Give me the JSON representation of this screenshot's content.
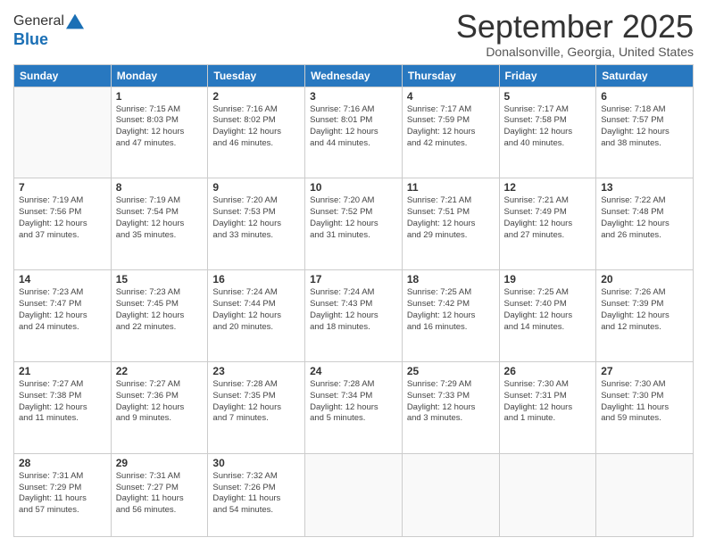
{
  "header": {
    "logo_line1": "General",
    "logo_line2": "Blue",
    "month_title": "September 2025",
    "subtitle": "Donalsonville, Georgia, United States"
  },
  "days_of_week": [
    "Sunday",
    "Monday",
    "Tuesday",
    "Wednesday",
    "Thursday",
    "Friday",
    "Saturday"
  ],
  "weeks": [
    [
      {
        "day": "",
        "info": ""
      },
      {
        "day": "1",
        "info": "Sunrise: 7:15 AM\nSunset: 8:03 PM\nDaylight: 12 hours\nand 47 minutes."
      },
      {
        "day": "2",
        "info": "Sunrise: 7:16 AM\nSunset: 8:02 PM\nDaylight: 12 hours\nand 46 minutes."
      },
      {
        "day": "3",
        "info": "Sunrise: 7:16 AM\nSunset: 8:01 PM\nDaylight: 12 hours\nand 44 minutes."
      },
      {
        "day": "4",
        "info": "Sunrise: 7:17 AM\nSunset: 7:59 PM\nDaylight: 12 hours\nand 42 minutes."
      },
      {
        "day": "5",
        "info": "Sunrise: 7:17 AM\nSunset: 7:58 PM\nDaylight: 12 hours\nand 40 minutes."
      },
      {
        "day": "6",
        "info": "Sunrise: 7:18 AM\nSunset: 7:57 PM\nDaylight: 12 hours\nand 38 minutes."
      }
    ],
    [
      {
        "day": "7",
        "info": "Sunrise: 7:19 AM\nSunset: 7:56 PM\nDaylight: 12 hours\nand 37 minutes."
      },
      {
        "day": "8",
        "info": "Sunrise: 7:19 AM\nSunset: 7:54 PM\nDaylight: 12 hours\nand 35 minutes."
      },
      {
        "day": "9",
        "info": "Sunrise: 7:20 AM\nSunset: 7:53 PM\nDaylight: 12 hours\nand 33 minutes."
      },
      {
        "day": "10",
        "info": "Sunrise: 7:20 AM\nSunset: 7:52 PM\nDaylight: 12 hours\nand 31 minutes."
      },
      {
        "day": "11",
        "info": "Sunrise: 7:21 AM\nSunset: 7:51 PM\nDaylight: 12 hours\nand 29 minutes."
      },
      {
        "day": "12",
        "info": "Sunrise: 7:21 AM\nSunset: 7:49 PM\nDaylight: 12 hours\nand 27 minutes."
      },
      {
        "day": "13",
        "info": "Sunrise: 7:22 AM\nSunset: 7:48 PM\nDaylight: 12 hours\nand 26 minutes."
      }
    ],
    [
      {
        "day": "14",
        "info": "Sunrise: 7:23 AM\nSunset: 7:47 PM\nDaylight: 12 hours\nand 24 minutes."
      },
      {
        "day": "15",
        "info": "Sunrise: 7:23 AM\nSunset: 7:45 PM\nDaylight: 12 hours\nand 22 minutes."
      },
      {
        "day": "16",
        "info": "Sunrise: 7:24 AM\nSunset: 7:44 PM\nDaylight: 12 hours\nand 20 minutes."
      },
      {
        "day": "17",
        "info": "Sunrise: 7:24 AM\nSunset: 7:43 PM\nDaylight: 12 hours\nand 18 minutes."
      },
      {
        "day": "18",
        "info": "Sunrise: 7:25 AM\nSunset: 7:42 PM\nDaylight: 12 hours\nand 16 minutes."
      },
      {
        "day": "19",
        "info": "Sunrise: 7:25 AM\nSunset: 7:40 PM\nDaylight: 12 hours\nand 14 minutes."
      },
      {
        "day": "20",
        "info": "Sunrise: 7:26 AM\nSunset: 7:39 PM\nDaylight: 12 hours\nand 12 minutes."
      }
    ],
    [
      {
        "day": "21",
        "info": "Sunrise: 7:27 AM\nSunset: 7:38 PM\nDaylight: 12 hours\nand 11 minutes."
      },
      {
        "day": "22",
        "info": "Sunrise: 7:27 AM\nSunset: 7:36 PM\nDaylight: 12 hours\nand 9 minutes."
      },
      {
        "day": "23",
        "info": "Sunrise: 7:28 AM\nSunset: 7:35 PM\nDaylight: 12 hours\nand 7 minutes."
      },
      {
        "day": "24",
        "info": "Sunrise: 7:28 AM\nSunset: 7:34 PM\nDaylight: 12 hours\nand 5 minutes."
      },
      {
        "day": "25",
        "info": "Sunrise: 7:29 AM\nSunset: 7:33 PM\nDaylight: 12 hours\nand 3 minutes."
      },
      {
        "day": "26",
        "info": "Sunrise: 7:30 AM\nSunset: 7:31 PM\nDaylight: 12 hours\nand 1 minute."
      },
      {
        "day": "27",
        "info": "Sunrise: 7:30 AM\nSunset: 7:30 PM\nDaylight: 11 hours\nand 59 minutes."
      }
    ],
    [
      {
        "day": "28",
        "info": "Sunrise: 7:31 AM\nSunset: 7:29 PM\nDaylight: 11 hours\nand 57 minutes."
      },
      {
        "day": "29",
        "info": "Sunrise: 7:31 AM\nSunset: 7:27 PM\nDaylight: 11 hours\nand 56 minutes."
      },
      {
        "day": "30",
        "info": "Sunrise: 7:32 AM\nSunset: 7:26 PM\nDaylight: 11 hours\nand 54 minutes."
      },
      {
        "day": "",
        "info": ""
      },
      {
        "day": "",
        "info": ""
      },
      {
        "day": "",
        "info": ""
      },
      {
        "day": "",
        "info": ""
      }
    ]
  ]
}
